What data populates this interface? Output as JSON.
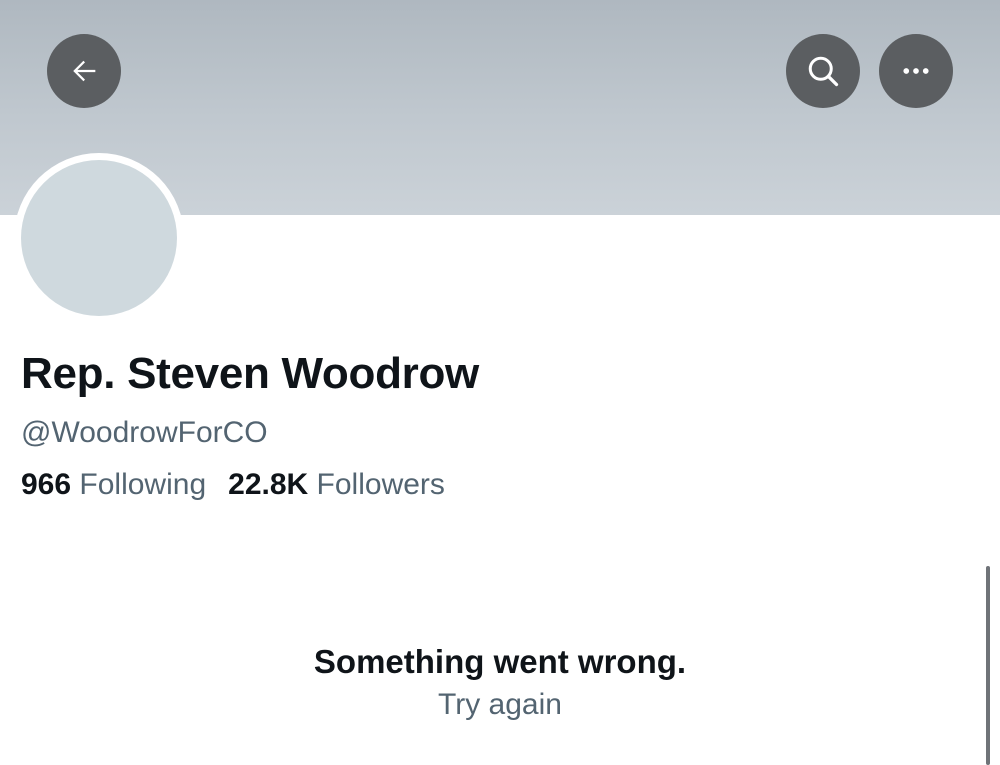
{
  "header": {
    "back_icon": "arrow-left-icon",
    "search_icon": "search-icon",
    "more_icon": "more-horizontal-icon",
    "button_color": "#5b5e61",
    "banner_color": "#c0c8cf"
  },
  "profile": {
    "display_name": "Rep. Steven Woodrow",
    "handle": "@WoodrowForCO",
    "following_count": "966",
    "following_label": "Following",
    "followers_count": "22.8K",
    "followers_label": "Followers",
    "avatar_color": "#cfd9de"
  },
  "error": {
    "message": "Something went wrong.",
    "retry_label": "Try again"
  }
}
